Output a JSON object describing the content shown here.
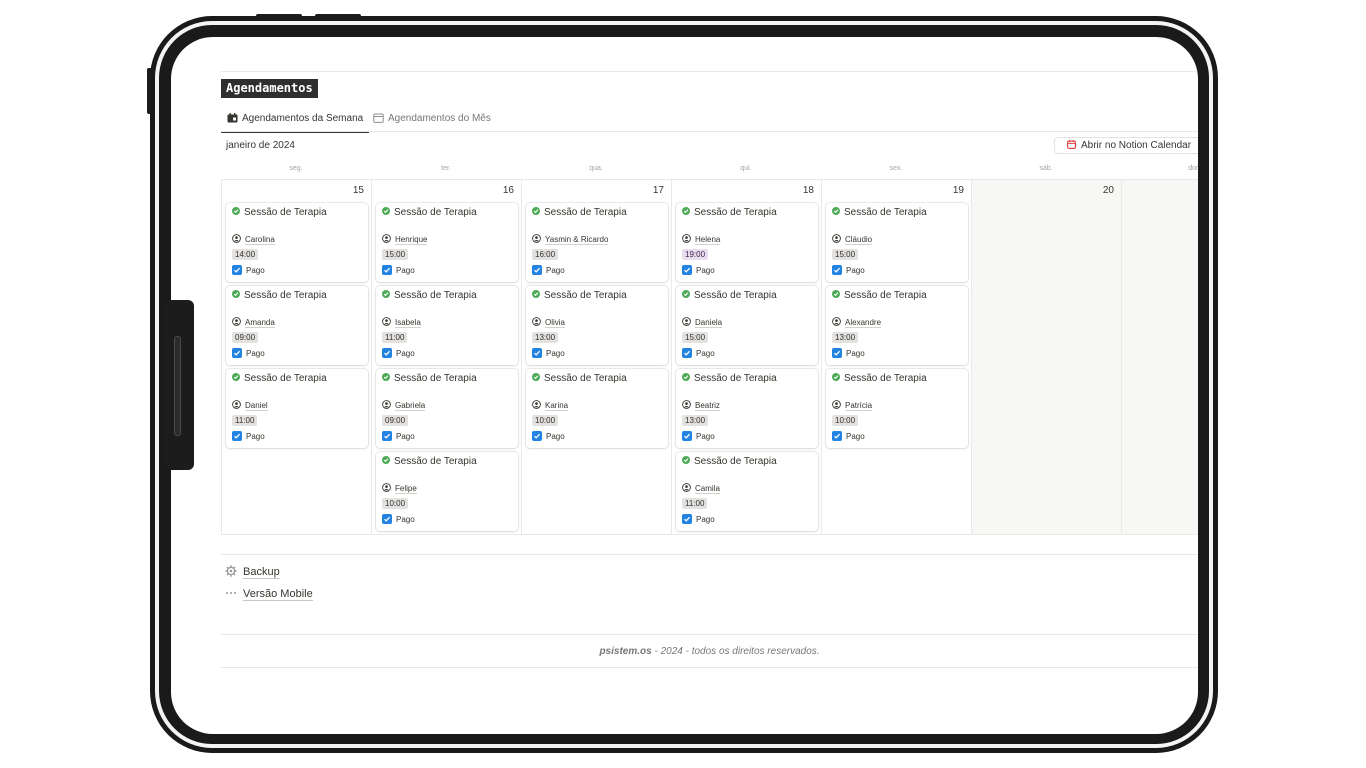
{
  "database": {
    "title": "Agendamentos"
  },
  "views": [
    {
      "label": "Agendamentos da Semana",
      "icon": "calendar-filled-icon",
      "active": true
    },
    {
      "label": "Agendamentos do Mês",
      "icon": "calendar-outline-icon",
      "active": false
    }
  ],
  "calendar": {
    "month_label": "janeiro de 2024",
    "open_button": {
      "label": "Abrir no Notion Calendar",
      "icon": "notion-calendar-icon",
      "icon_color": "#e03e3e"
    },
    "weekdays": [
      "seg.",
      "ter.",
      "qua.",
      "qui.",
      "sex.",
      "sáb.",
      "dom."
    ],
    "days": [
      {
        "number": "15",
        "weekend": false,
        "events": [
          {
            "title": "Sessão de Terapia",
            "person": "Carolina",
            "time": "14:00",
            "time_color": "gray",
            "paid_label": "Pago"
          },
          {
            "title": "Sessão de Terapia",
            "person": "Amanda",
            "time": "09:00",
            "time_color": "gray",
            "paid_label": "Pago"
          },
          {
            "title": "Sessão de Terapia",
            "person": "Daniel",
            "time": "11:00",
            "time_color": "gray",
            "paid_label": "Pago"
          }
        ]
      },
      {
        "number": "16",
        "weekend": false,
        "events": [
          {
            "title": "Sessão de Terapia",
            "person": "Henrique",
            "time": "15:00",
            "time_color": "gray",
            "paid_label": "Pago"
          },
          {
            "title": "Sessão de Terapia",
            "person": "Isabela",
            "time": "11:00",
            "time_color": "gray",
            "paid_label": "Pago"
          },
          {
            "title": "Sessão de Terapia",
            "person": "Gabriela",
            "time": "09:00",
            "time_color": "gray",
            "paid_label": "Pago"
          },
          {
            "title": "Sessão de Terapia",
            "person": "Felipe",
            "time": "10:00",
            "time_color": "gray",
            "paid_label": "Pago"
          }
        ]
      },
      {
        "number": "17",
        "weekend": false,
        "events": [
          {
            "title": "Sessão de Terapia",
            "person": "Yasmin & Ricardo",
            "time": "16:00",
            "time_color": "gray",
            "paid_label": "Pago"
          },
          {
            "title": "Sessão de Terapia",
            "person": "Olivia",
            "time": "13:00",
            "time_color": "gray",
            "paid_label": "Pago"
          },
          {
            "title": "Sessão de Terapia",
            "person": "Karina",
            "time": "10:00",
            "time_color": "gray",
            "paid_label": "Pago"
          }
        ]
      },
      {
        "number": "18",
        "weekend": false,
        "events": [
          {
            "title": "Sessão de Terapia",
            "person": "Helena",
            "time": "19:00",
            "time_color": "purple",
            "paid_label": "Pago"
          },
          {
            "title": "Sessão de Terapia",
            "person": "Daniela",
            "time": "15:00",
            "time_color": "gray",
            "paid_label": "Pago"
          },
          {
            "title": "Sessão de Terapia",
            "person": "Beatriz",
            "time": "13:00",
            "time_color": "gray",
            "paid_label": "Pago"
          },
          {
            "title": "Sessão de Terapia",
            "person": "Camila",
            "time": "11:00",
            "time_color": "gray",
            "paid_label": "Pago"
          }
        ]
      },
      {
        "number": "19",
        "weekend": false,
        "events": [
          {
            "title": "Sessão de Terapia",
            "person": "Cláudio",
            "time": "15:00",
            "time_color": "gray",
            "paid_label": "Pago"
          },
          {
            "title": "Sessão de Terapia",
            "person": "Alexandre",
            "time": "13:00",
            "time_color": "gray",
            "paid_label": "Pago"
          },
          {
            "title": "Sessão de Terapia",
            "person": "Patrícia",
            "time": "10:00",
            "time_color": "gray",
            "paid_label": "Pago"
          }
        ]
      },
      {
        "number": "20",
        "weekend": true,
        "events": []
      },
      {
        "number": "",
        "weekend": true,
        "events": []
      }
    ]
  },
  "links": [
    {
      "label": "Backup",
      "icon": "gear-icon"
    },
    {
      "label": "Versão Mobile",
      "icon": "ellipsis-icon"
    }
  ],
  "footer": {
    "brand": "psistem.os",
    "text": " - 2024 - todos os direitos reservados."
  },
  "colors": {
    "status_green": "#4daa57",
    "checkbox_blue": "#2383e2",
    "time_purple_bg": "#e8deee",
    "time_gray_bg": "#e3e2e0"
  }
}
